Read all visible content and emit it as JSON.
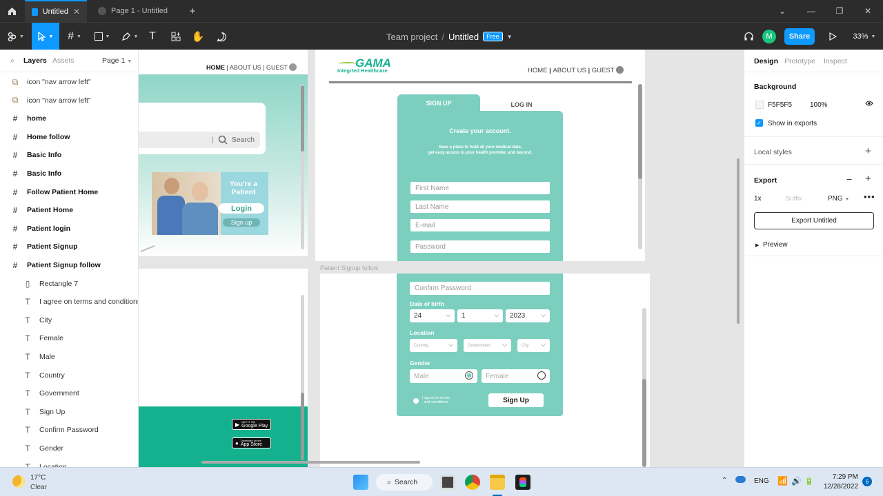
{
  "titlebar": {
    "tabs": [
      {
        "label": "Untitled",
        "active": true
      },
      {
        "label": "Page 1 - Untitled",
        "active": false
      }
    ]
  },
  "toolbar": {
    "team": "Team project",
    "separator": "/",
    "file": "Untitled",
    "plan_badge": "Free",
    "avatar_initial": "M",
    "share_label": "Share",
    "zoom": "33%"
  },
  "layers_panel": {
    "tab_layers": "Layers",
    "tab_assets": "Assets",
    "page": "Page 1",
    "items": [
      {
        "type": "component",
        "label": "icon \"nav arrow left\""
      },
      {
        "type": "component",
        "label": "icon \"nav arrow left\""
      },
      {
        "type": "frame",
        "label": "home"
      },
      {
        "type": "frame",
        "label": "Home follow"
      },
      {
        "type": "frame",
        "label": "Basic Info"
      },
      {
        "type": "frame",
        "label": "Basic Info"
      },
      {
        "type": "frame",
        "label": "Follow Patient Home"
      },
      {
        "type": "frame",
        "label": "Patient Home"
      },
      {
        "type": "frame",
        "label": "Patient login"
      },
      {
        "type": "frame",
        "label": "Patient Signup"
      },
      {
        "type": "frame",
        "label": "Patient Signup follow"
      },
      {
        "type": "rect",
        "label": "Rectangle 7"
      },
      {
        "type": "text",
        "label": "I agree on terms and conditions"
      },
      {
        "type": "text",
        "label": "City"
      },
      {
        "type": "text",
        "label": "Female"
      },
      {
        "type": "text",
        "label": "Male"
      },
      {
        "type": "text",
        "label": "Country"
      },
      {
        "type": "text",
        "label": "Government"
      },
      {
        "type": "text",
        "label": "Sign Up"
      },
      {
        "type": "text",
        "label": "Confirm Password"
      },
      {
        "type": "text",
        "label": "Gender"
      },
      {
        "type": "text",
        "label": "Location"
      }
    ]
  },
  "design_panel": {
    "tab_design": "Design",
    "tab_prototype": "Prototype",
    "tab_inspect": "Inspect",
    "background_title": "Background",
    "bg_hex": "F5F5F5",
    "bg_opacity": "100%",
    "show_in_exports": "Show in exports",
    "local_styles": "Local styles",
    "export_title": "Export",
    "export_scale": "1x",
    "export_suffix_placeholder": "Suffix",
    "export_format": "PNG",
    "export_button": "Export Untitled",
    "preview": "Preview"
  },
  "canvas": {
    "home_frame": {
      "nav_home": "HOME",
      "nav_about": "ABOUT US",
      "nav_guest": "GUEST",
      "search_placeholder": "Search",
      "card_title": "You're a Patient",
      "login_button": "Login",
      "signup_button": "Sign up",
      "google_play_small": "GET IT ON",
      "google_play": "Google Play",
      "app_store_small": "Download on the",
      "app_store": "App Store"
    },
    "signup_frame": {
      "logo": "GAMA",
      "logo_sub": "Integrted Healthcare",
      "nav_home": "HOME",
      "nav_about": "ABOUT US",
      "nav_guest": "GUEST",
      "tab_signup": "SIGN UP",
      "tab_login": "LOG IN",
      "heading": "Create your account.",
      "subtext_1": "Have a place to hold all your medical data,",
      "subtext_2": "get easy access to your health provider, and beyond.",
      "first_name": "First Name",
      "last_name": "Last Name",
      "email": "E-mail",
      "password": "Password"
    },
    "follow_frame": {
      "frame_label": "Patient Signup follow",
      "confirm_password": "Confirm Password",
      "dob_label": "Date of birth",
      "dob_day": "24",
      "dob_month": "1",
      "dob_year": "2023",
      "location_label": "Location",
      "country": "Country",
      "government": "Government",
      "city": "City",
      "gender_label": "Gender",
      "male": "Male",
      "female": "Female",
      "terms_1": "I agree on terms",
      "terms_2": "and conditions",
      "signup_button": "Sign Up"
    }
  },
  "taskbar": {
    "temp": "17°C",
    "weather": "Clear",
    "search": "Search",
    "lang": "ENG",
    "time": "7:29 PM",
    "date": "12/28/2022",
    "notif_count": "6"
  },
  "colors": {
    "accent": "#0d99ff",
    "mint": "#7ccfbe",
    "teal_dark": "#14b18f",
    "share_blue": "#0d99ff",
    "avatar_green": "#1bc47d"
  }
}
